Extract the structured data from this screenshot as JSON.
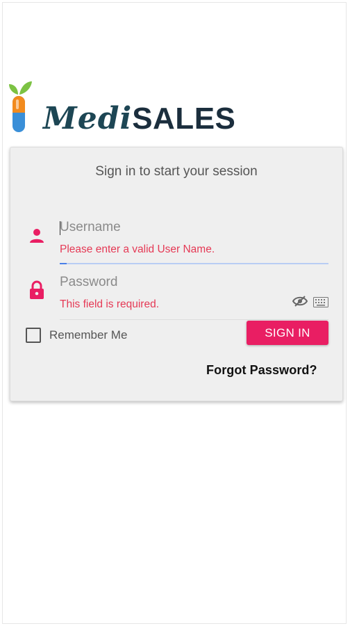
{
  "brand": {
    "logo_part1": "Medi",
    "logo_part2": "SALES",
    "colors": {
      "accent": "#e91e63",
      "logo_dark": "#1b2e3d",
      "pill_orange": "#f28b1e",
      "pill_blue": "#3a8fd8",
      "leaf_green": "#7cc243"
    }
  },
  "login": {
    "title": "Sign in to start your session",
    "username": {
      "placeholder": "Username",
      "value": "",
      "error": "Please enter a valid User Name.",
      "icon": "person-icon"
    },
    "password": {
      "placeholder": "Password",
      "value": "",
      "error": "This field is required.",
      "icon": "lock-icon",
      "toggle_icon": "eye-off-icon",
      "keyboard_icon": "keyboard-icon"
    },
    "remember_label": "Remember Me",
    "remember_checked": false,
    "sign_in_label": "SIGN IN",
    "forgot_label": "Forgot Password?"
  },
  "colors": {
    "error": "#e53955",
    "icon_pink": "#e91e63",
    "focus_line": "#4a80e8"
  }
}
